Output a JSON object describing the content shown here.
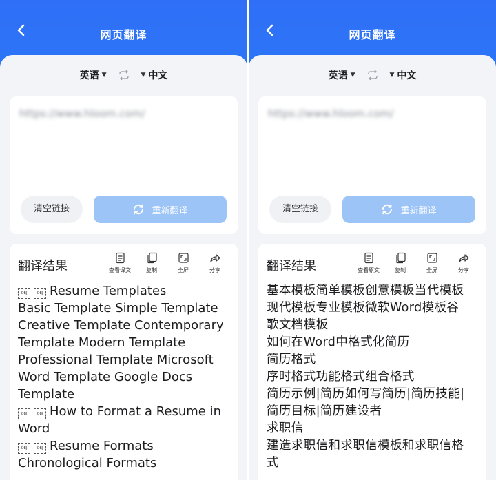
{
  "left": {
    "header": {
      "title": "网页翻译"
    },
    "language": {
      "source": "英语",
      "target": "中文"
    },
    "input": {
      "url": "https://www.hloom.com/"
    },
    "buttons": {
      "clear": "清空链接",
      "retranslate": "重新翻译"
    },
    "result": {
      "title": "翻译结果",
      "tools": [
        "查看译文",
        "复制",
        "全屏",
        "分享"
      ],
      "lines": [
        {
          "ph": true,
          "text": "Resume Templates"
        },
        {
          "ph": false,
          "text": "Basic Template Simple Template"
        },
        {
          "ph": false,
          "text": "Creative Template Contemporary"
        },
        {
          "ph": false,
          "text": "Template Modern Template"
        },
        {
          "ph": false,
          "text": "Professional Template Microsoft"
        },
        {
          "ph": false,
          "text": "Word Template Google Docs"
        },
        {
          "ph": false,
          "text": "Template"
        },
        {
          "ph": true,
          "text": "How to Format a Resume in"
        },
        {
          "ph": false,
          "text": "Word"
        },
        {
          "ph": true,
          "text": "Resume Formats"
        },
        {
          "ph": false,
          "text": "Chronological Formats"
        }
      ]
    }
  },
  "right": {
    "header": {
      "title": "网页翻译"
    },
    "language": {
      "source": "英语",
      "target": "中文"
    },
    "input": {
      "url": "https://www.hloom.com/"
    },
    "buttons": {
      "clear": "清空链接",
      "retranslate": "重新翻译"
    },
    "result": {
      "title": "翻译结果",
      "tools": [
        "查看原文",
        "复制",
        "全屏",
        "分享"
      ],
      "lines": [
        "基本模板简单模板创意模板当代模板",
        "现代模板专业模板微软Word模板谷",
        "歌文档模板",
        "如何在Word中格式化简历",
        "简历格式",
        "序时格式功能格式组合格式",
        "简历示例|简历如何写简历|简历技能|",
        "简历目标|简历建设者",
        "求职信",
        "建造求职信和求职信模板和求职信格",
        "式"
      ]
    }
  },
  "placeholder_glyph": "OBJ",
  "icons": [
    "back-icon",
    "swap-icon",
    "refresh-icon",
    "view-text-icon",
    "copy-icon",
    "fullscreen-icon",
    "share-icon"
  ],
  "colors": {
    "header_blue": "#2f6ff7",
    "button_blue": "#9cc4f7",
    "sheet_bg": "#f2f4f7"
  }
}
